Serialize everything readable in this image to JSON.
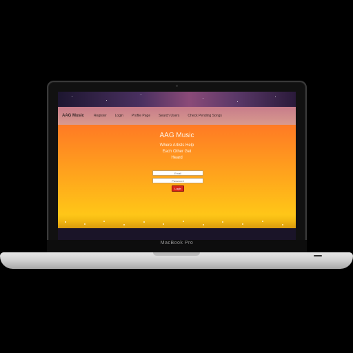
{
  "device": {
    "model_label": "MacBook Pro"
  },
  "navbar": {
    "brand": "AAG Music",
    "links": [
      "Register",
      "Login",
      "Profile Page",
      "Search Users",
      "Check Pending Songs"
    ]
  },
  "hero": {
    "title": "AAG Music",
    "tagline_lines": [
      "Where Artists Help",
      "Each Other Get",
      "Heard"
    ]
  },
  "login_form": {
    "email_placeholder": "Email",
    "password_placeholder": "Password",
    "submit_label": "Login"
  },
  "colors": {
    "login_button": "#d8261a",
    "gradient_top": "#ff7a24",
    "gradient_bottom": "#ffd21a"
  }
}
